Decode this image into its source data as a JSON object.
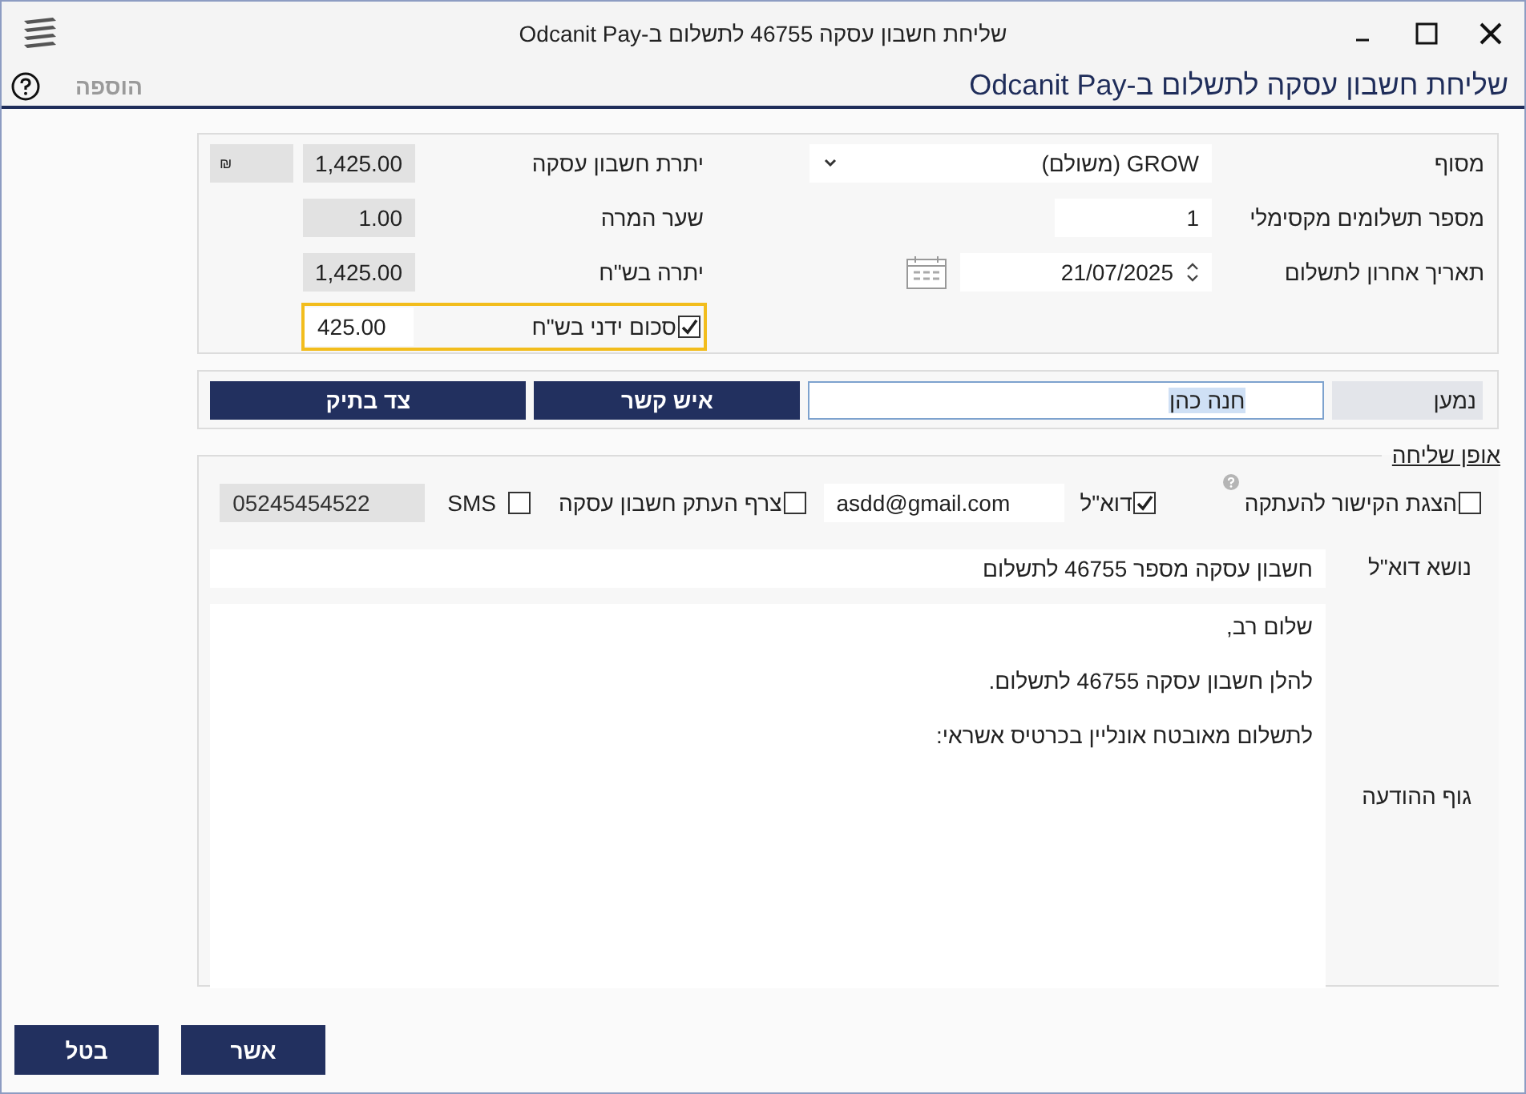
{
  "window": {
    "title": "שליחת חשבון עסקה 46755 לתשלום ב-Odcanit Pay"
  },
  "header": {
    "title": "שליחת חשבון עסקה לתשלום ב-Odcanit Pay",
    "add_button": {
      "label": "הוספה",
      "disabled": true
    }
  },
  "payment": {
    "terminal": {
      "label": "מסוף",
      "value": "GROW (משולם)"
    },
    "max_payments": {
      "label": "מספר תשלומים מקסימלי",
      "value": "1"
    },
    "due_date": {
      "label": "תאריך אחרון לתשלום",
      "value": "21/07/2025"
    },
    "balance": {
      "label": "יתרת חשבון עסקה",
      "value": "1,425.00",
      "currency": "₪"
    },
    "exchange_rate": {
      "label": "שער המרה",
      "value": "1.00"
    },
    "balance_ils": {
      "label": "יתרה בש\"ח",
      "value": "1,425.00"
    },
    "manual_amount": {
      "label": "סכום ידני בש\"ח",
      "checked": true,
      "value": "425.00"
    }
  },
  "recipient": {
    "label": "נמען",
    "value": "חנה כהן",
    "buttons": [
      "איש קשר",
      "צד בתיק"
    ]
  },
  "sending": {
    "legend": "אופן שליחה",
    "copy_link": {
      "label": "הצגת הקישור להעתקה",
      "checked": false
    },
    "email": {
      "label": "דוא\"ל",
      "checked": true,
      "address": "asdd@gmail.com"
    },
    "attach_copy": {
      "label": "צרף העתק חשבון עסקה",
      "checked": false
    },
    "sms": {
      "label": "SMS",
      "checked": false,
      "phone": "05245454522"
    },
    "subject": {
      "label": "נושא דוא\"ל",
      "value": "חשבון עסקה מספר 46755 לתשלום"
    },
    "body": {
      "label": "גוף ההודעה",
      "lines": [
        "שלום רב,",
        "להלן חשבון עסקה 46755 לתשלום.",
        "לתשלום מאובטח אונליין בכרטיס אשראי:"
      ]
    }
  },
  "footer": {
    "buttons": [
      "אשר",
      "בטל"
    ]
  }
}
